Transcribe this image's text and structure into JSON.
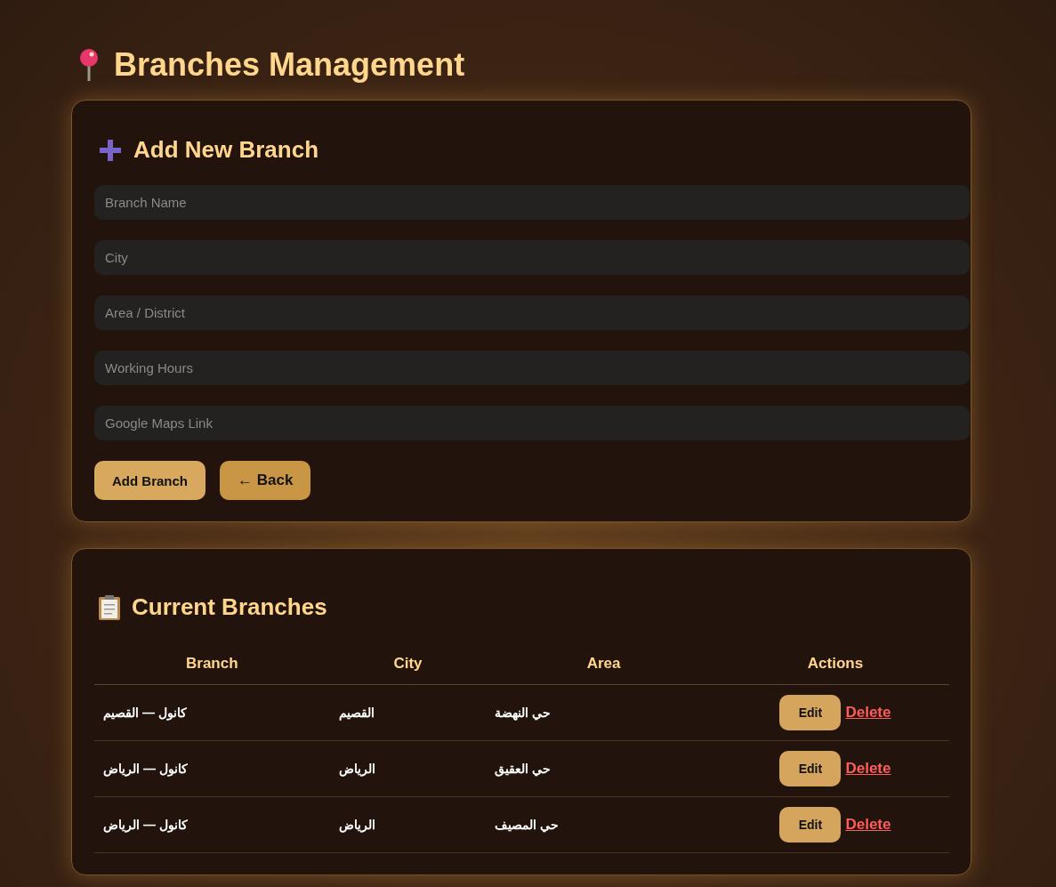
{
  "title": "Branches Management",
  "add_form": {
    "heading": "Add New Branch",
    "fields": [
      {
        "placeholder": "Branch Name"
      },
      {
        "placeholder": "City"
      },
      {
        "placeholder": "Area / District"
      },
      {
        "placeholder": "Working Hours"
      },
      {
        "placeholder": "Google Maps Link"
      }
    ],
    "add_button": {
      "label": "Add Branch"
    },
    "back_button": {
      "label": "← Back"
    }
  },
  "branches": {
    "heading": "Current Branches",
    "column_headers": {
      "branch": "Branch",
      "city": "City",
      "area": "Area",
      "actions": "Actions"
    },
    "rows": [
      {
        "branch": "كانول — القصيم",
        "city": "القصيم",
        "area": "حي النهضة",
        "edit": "Edit",
        "delete": "Delete"
      },
      {
        "branch": "كانول — الرياض",
        "city": "الرياض",
        "area": "حي العقيق",
        "edit": "Edit",
        "delete": "Delete"
      },
      {
        "branch": "كانول — الرياض",
        "city": "الرياض",
        "area": "حي المصيف",
        "edit": "Edit",
        "delete": "Delete"
      }
    ]
  }
}
